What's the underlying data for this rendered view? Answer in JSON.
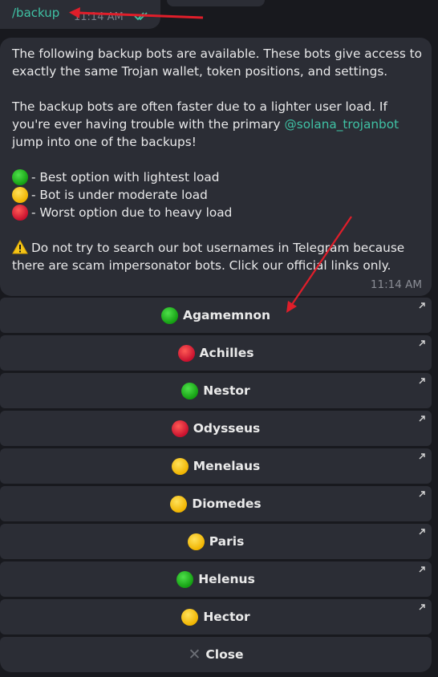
{
  "outgoing": {
    "command": "/backup",
    "time": "11:14 AM"
  },
  "message": {
    "intro": "The following backup bots are available. These bots give access to exactly the same Trojan wallet, token positions, and settings.",
    "para2_before": "The backup bots are often faster due to a lighter user load. If you're ever having trouble with the primary ",
    "mention": "@solana_trojanbot",
    "para2_after": " jump into one of the backups!",
    "legend": [
      {
        "status": "green",
        "text": " - Best option with lightest load"
      },
      {
        "status": "yellow",
        "text": " - Bot is under moderate load"
      },
      {
        "status": "red",
        "text": " - Worst option due to heavy load"
      }
    ],
    "warning": "Do not try to search our bot usernames in Telegram because there are scam impersonator bots. Click our official links only.",
    "time": "11:14 AM"
  },
  "keyboard": {
    "buttons": [
      {
        "label": "Agamemnon",
        "status": "green"
      },
      {
        "label": "Achilles",
        "status": "red"
      },
      {
        "label": "Nestor",
        "status": "green"
      },
      {
        "label": "Odysseus",
        "status": "red"
      },
      {
        "label": "Menelaus",
        "status": "yellow"
      },
      {
        "label": "Diomedes",
        "status": "yellow"
      },
      {
        "label": "Paris",
        "status": "yellow"
      },
      {
        "label": "Helenus",
        "status": "green"
      },
      {
        "label": "Hector",
        "status": "yellow"
      }
    ],
    "close_label": "Close"
  },
  "colors": {
    "accent": "#3fc1a4",
    "bubble": "#2b2d35",
    "background": "#18191e",
    "annotation_arrow": "#e01e2a"
  }
}
